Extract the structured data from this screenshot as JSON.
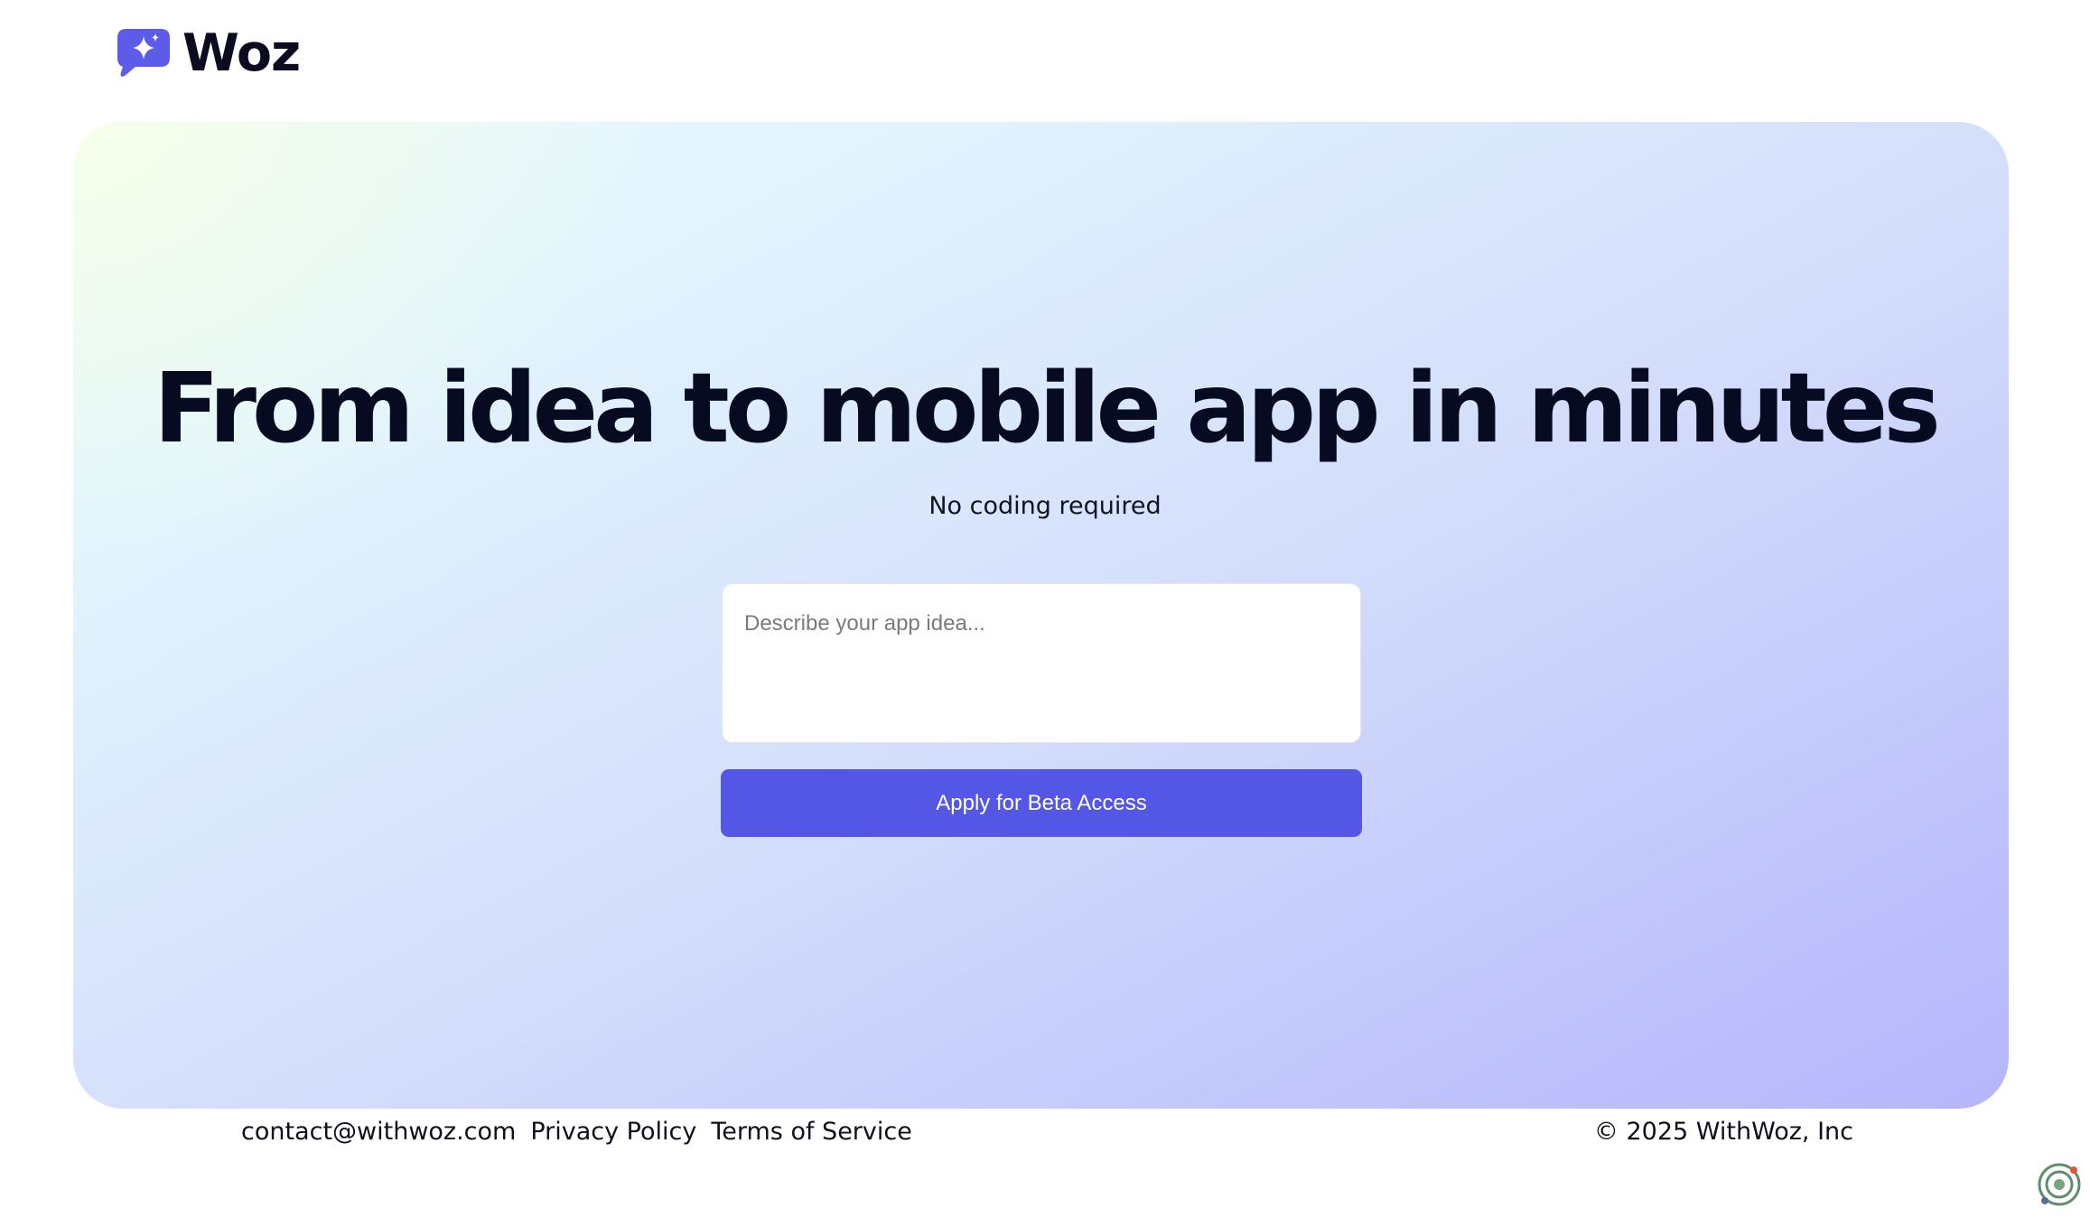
{
  "header": {
    "brand_name": "Woz",
    "logo_icon": "chat-sparkle-icon"
  },
  "hero": {
    "headline": "From idea to mobile app in minutes",
    "subheadline": "No coding required",
    "idea_input": {
      "value": "",
      "placeholder": "Describe your app idea..."
    },
    "apply_button_label": "Apply for Beta Access"
  },
  "footer": {
    "links": [
      {
        "label": "contact@withwoz.com"
      },
      {
        "label": "Privacy Policy"
      },
      {
        "label": "Terms of Service"
      }
    ],
    "copyright": "© 2025 WithWoz, Inc"
  },
  "colors": {
    "accent": "#5457e6",
    "headline_text": "#070b22",
    "logo_bubble": "#5c5ce8"
  },
  "corner_widget_icon": "radar-widget-icon"
}
